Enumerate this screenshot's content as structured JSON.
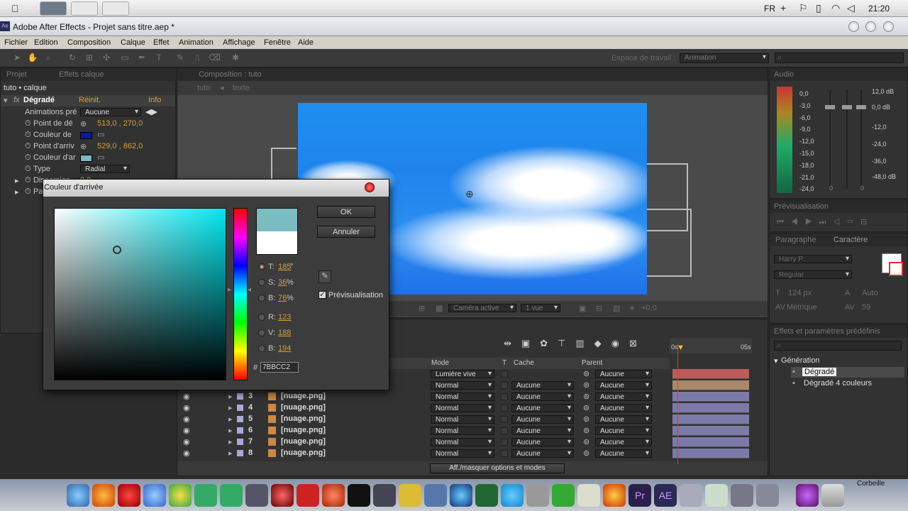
{
  "macbar": {
    "lang": "FR",
    "clock": "21:20"
  },
  "window": {
    "app_icon": "Ae",
    "title": "Adobe After Effects - Projet sans titre.aep *"
  },
  "menu": [
    "Fichier",
    "Edition",
    "Composition",
    "Calque",
    "Effet",
    "Animation",
    "Affichage",
    "Fenêtre",
    "Aide"
  ],
  "toolbar": {
    "workspace_label": "Espace de travail :",
    "workspace_value": "Animation"
  },
  "left_panel": {
    "tabs": [
      "Projet",
      "Effets calque"
    ],
    "breadcrumb": "tuto • calque",
    "effect_name": "Dégradé",
    "reset": "Réinit.",
    "info": "Info",
    "rows": {
      "anim_label": "Animations pré",
      "anim_value": "Aucune",
      "start_label": "Point de dé",
      "start_value": "513,0 , 270,0",
      "start_color_label": "Couleur de",
      "end_label": "Point d'arriv",
      "end_value": "529,0 , 862,0",
      "end_color_label": "Couleur d'ar",
      "type_label": "Type",
      "type_value": "Radial",
      "disp_label": "Dispersion",
      "disp_value": "0,0",
      "p_label": "Pa"
    }
  },
  "comp": {
    "tab": "Composition : tuto",
    "crumbs": [
      "tuto",
      "texte"
    ],
    "camera": "Caméra active",
    "view": "1 vue",
    "offset": "+0,0"
  },
  "dialog": {
    "title": "Couleur d'arrivée",
    "ok": "OK",
    "cancel": "Annuler",
    "preview": "Prévisualisation",
    "t_label": "T:",
    "t_value": "185",
    "t_unit": "°",
    "s_label": "S:",
    "s_value": "36",
    "s_unit": "%",
    "b_label": "B:",
    "b_value": "76",
    "b_unit": "%",
    "r_label": "R:",
    "r_value": "123",
    "v_label": "V:",
    "v_value": "188",
    "b2_label": "B:",
    "b2_value": "194",
    "hash": "#",
    "hex": "7BBCC2",
    "new_color": "#7bbcc2",
    "old_color": "#ffffff"
  },
  "audio": {
    "tab": "Audio",
    "left_scale": [
      "0,0",
      "-3,0",
      "-6,0",
      "-9,0",
      "-12,0",
      "-15,0",
      "-18,0",
      "-21,0",
      "-24,0"
    ],
    "right_scale": [
      "12,0 dB",
      "0,0 dB",
      "-12,0",
      "-24,0",
      "-36,0",
      "-48,0 dB"
    ],
    "zeros": [
      "0",
      "0"
    ]
  },
  "preview": {
    "tab": "Prévisualisation"
  },
  "char": {
    "tabs": [
      "Paragraphe",
      "Caractère"
    ],
    "font": "Harry P",
    "style": "Regular",
    "size": "124 px",
    "leading": "Auto",
    "kern": "Métrique",
    "track": "59"
  },
  "effects_presets": {
    "tab": "Effets et paramètres prédéfinis",
    "category": "Génération",
    "items": [
      "Dégradé",
      "Dégradé 4 couleurs"
    ]
  },
  "timeline": {
    "headers": {
      "mode": "Mode",
      "t": "T",
      "cache": "Cache",
      "parent": "Parent"
    },
    "time_start": "0s",
    "time_end": "05s",
    "rows": [
      {
        "num": "",
        "name": "",
        "mode": "Lumière vive",
        "cache": "",
        "parent": "Aucune"
      },
      {
        "num": "",
        "name": "",
        "mode": "Normal",
        "cache": "Aucune",
        "parent": "Aucune"
      },
      {
        "num": "3",
        "name": "[nuage.png]",
        "mode": "Normal",
        "cache": "Aucune",
        "parent": "Aucune"
      },
      {
        "num": "4",
        "name": "[nuage.png]",
        "mode": "Normal",
        "cache": "Aucune",
        "parent": "Aucune"
      },
      {
        "num": "5",
        "name": "[nuage.png]",
        "mode": "Normal",
        "cache": "Aucune",
        "parent": "Aucune"
      },
      {
        "num": "6",
        "name": "[nuage.png]",
        "mode": "Normal",
        "cache": "Aucune",
        "parent": "Aucune"
      },
      {
        "num": "7",
        "name": "[nuage.png]",
        "mode": "Normal",
        "cache": "Aucune",
        "parent": "Aucune"
      },
      {
        "num": "8",
        "name": "[nuage.png]",
        "mode": "Normal",
        "cache": "Aucune",
        "parent": "Aucune"
      }
    ],
    "footer": "Aff./masquer options et modes"
  },
  "dock": {
    "trash_label": "Corbeille"
  }
}
